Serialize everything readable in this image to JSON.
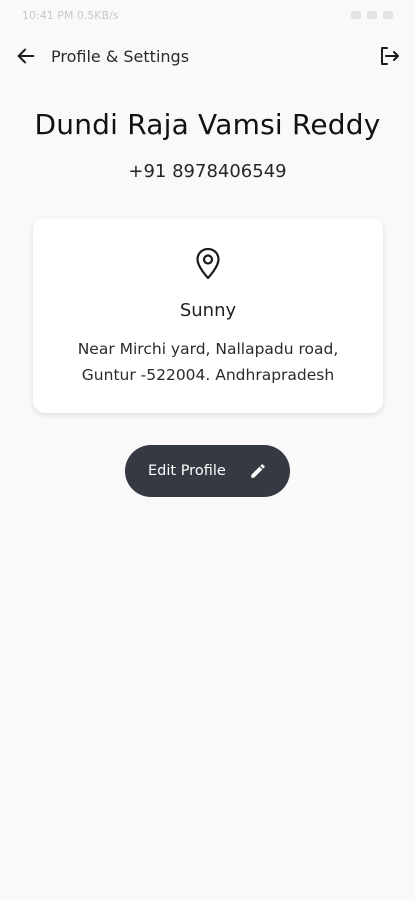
{
  "status_bar": {
    "left_text": "10:41 PM 0.5KB/s"
  },
  "app_bar": {
    "title": "Profile & Settings",
    "back_icon": "arrow-left-icon",
    "logout_icon": "logout-icon"
  },
  "profile": {
    "name": "Dundi Raja Vamsi Reddy",
    "phone": "+91 8978406549"
  },
  "address_card": {
    "icon": "location-pin-icon",
    "name": "Sunny",
    "address_line1": "Near Mirchi yard, Nallapadu road,",
    "address_line2": "Guntur -522004. Andhrapradesh"
  },
  "edit_button": {
    "label": "Edit Profile",
    "icon": "pencil-icon"
  },
  "colors": {
    "background": "#f9f9f9",
    "card": "#ffffff",
    "button": "#353942",
    "text_primary": "#121212"
  }
}
